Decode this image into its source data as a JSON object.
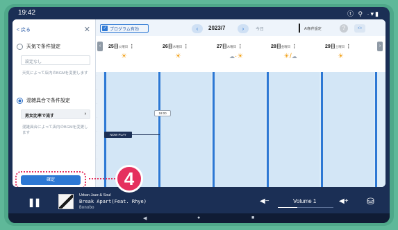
{
  "status_bar": {
    "time": "19:42",
    "icons": "ⓣ ⚲ ·▾▮"
  },
  "sidebar": {
    "back_label": "< 戻る",
    "close_glyph": "✕",
    "option1": {
      "label": "天気で条件設定",
      "select_value": "設定なし",
      "hint": "天気によって店内のBGMを変更します"
    },
    "option2": {
      "label": "混雑具合で条件設定",
      "select_value": "男女比率で流す",
      "hint": "混雑具合によって店内のBGMを変更します"
    },
    "confirm_label": "確定"
  },
  "topbar": {
    "program_toggle_label": "プログラム有効",
    "prev": "‹",
    "month": "2023/7",
    "next": "›",
    "today": "今日",
    "ai_label": "AI条件設定",
    "help": "?",
    "more": "‹:›"
  },
  "days": [
    {
      "date": "25日",
      "weekday": "火曜日",
      "weather": "☀",
      "cloud": ""
    },
    {
      "date": "26日",
      "weekday": "水曜日",
      "weather": "☀",
      "cloud": ""
    },
    {
      "date": "27日",
      "weekday": "木曜日",
      "weather": "☀",
      "cloud": "☁"
    },
    {
      "date": "28日",
      "weekday": "金曜日",
      "weather": "☀",
      "cloud": "☁"
    },
    {
      "date": "29日",
      "weekday": "土曜日",
      "weather": "☀",
      "cloud": ""
    }
  ],
  "grid": {
    "time_pill": "18:00",
    "now_label": "NOW PLAY"
  },
  "step_number": "4",
  "player": {
    "channel": "Urban Jazz & Soul",
    "track": "Break Apart(Feat. Rhye)",
    "artist": "Bonobo",
    "volume_label": "Volume 1",
    "volume_level": 0.35
  },
  "colors": {
    "accent": "#2d78d4",
    "marker": "#e5305e",
    "frame": "#4fa88a",
    "dark": "#1b2f55"
  }
}
